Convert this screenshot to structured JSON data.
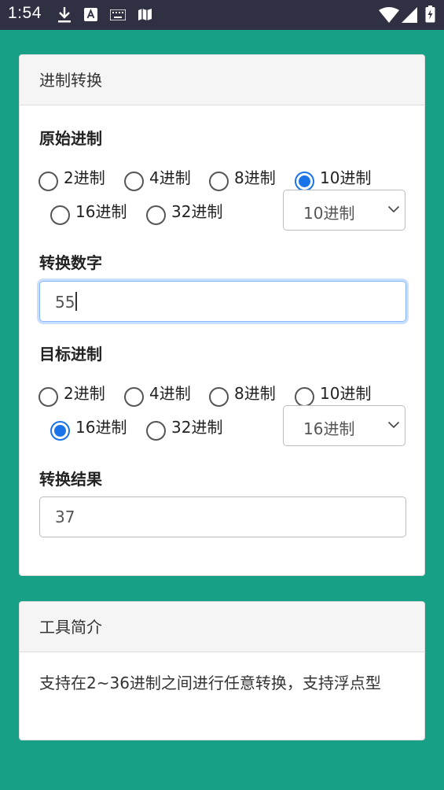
{
  "status_bar": {
    "time": "1:54"
  },
  "converter": {
    "title": "进制转换",
    "source": {
      "heading": "原始进制",
      "options": [
        "2进制",
        "4进制",
        "8进制",
        "10进制",
        "16进制",
        "32进制"
      ],
      "selected": "10进制",
      "select_value": "10进制"
    },
    "input": {
      "heading": "转换数字",
      "value": "55"
    },
    "target": {
      "heading": "目标进制",
      "options": [
        "2进制",
        "4进制",
        "8进制",
        "10进制",
        "16进制",
        "32进制"
      ],
      "selected": "16进制",
      "select_value": "16进制"
    },
    "result": {
      "heading": "转换结果",
      "value": "37"
    }
  },
  "intro": {
    "title": "工具简介",
    "text": "支持在2~36进制之间进行任意转换，支持浮点型"
  },
  "colors": {
    "background": "#17a086",
    "status_bar": "#2f3142",
    "accent": "#1a73e8"
  }
}
